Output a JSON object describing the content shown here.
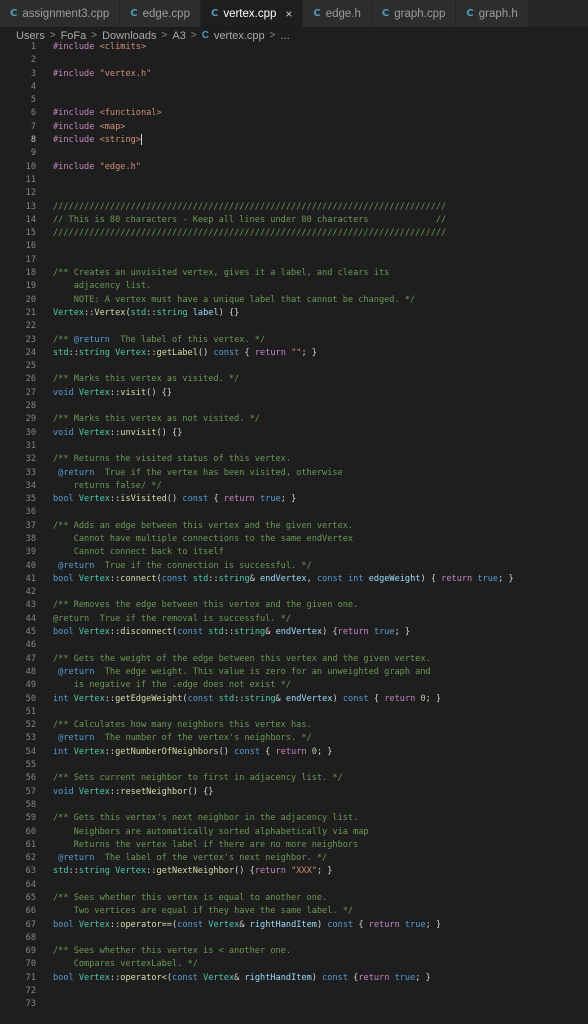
{
  "tabs": [
    {
      "label": "assignment3.cpp",
      "icon": "c-file-icon",
      "active": false
    },
    {
      "label": "edge.cpp",
      "icon": "c-file-icon",
      "active": false
    },
    {
      "label": "vertex.cpp",
      "icon": "c-file-icon",
      "active": true,
      "close": "×"
    },
    {
      "label": "edge.h",
      "icon": "c-file-icon",
      "active": false
    },
    {
      "label": "graph.cpp",
      "icon": "c-file-icon",
      "active": false
    },
    {
      "label": "graph.h",
      "icon": "c-file-icon",
      "active": false
    }
  ],
  "breadcrumb": {
    "items": [
      "Users",
      "FoFa",
      "Downloads",
      "A3",
      "vertex.cpp",
      "..."
    ],
    "separator": ">"
  },
  "editor": {
    "current_line": 8,
    "lines": [
      [
        [
          "#include ",
          "inc"
        ],
        [
          "<climits>",
          "str"
        ]
      ],
      [],
      [
        [
          "#include ",
          "inc"
        ],
        [
          "\"vertex.h\"",
          "str"
        ]
      ],
      [],
      [],
      [
        [
          "#include ",
          "inc"
        ],
        [
          "<functional>",
          "str"
        ]
      ],
      [
        [
          "#include ",
          "inc"
        ],
        [
          "<map>",
          "str"
        ]
      ],
      [
        [
          "#include ",
          "inc"
        ],
        [
          "<string>",
          "str"
        ]
      ],
      [],
      [
        [
          "#include ",
          "inc"
        ],
        [
          "\"edge.h\"",
          "str"
        ]
      ],
      [],
      [],
      [
        [
          "////////////////////////////////////////////////////////////////////////////",
          "cm"
        ]
      ],
      [
        [
          "// This is 80 characters - Keep all lines under 80 characters             //",
          "cm"
        ]
      ],
      [
        [
          "////////////////////////////////////////////////////////////////////////////",
          "cm"
        ]
      ],
      [],
      [],
      [
        [
          "/** Creates an unvisited vertex, gives it a label, and clears its",
          "cm"
        ]
      ],
      [
        [
          "    adjacency list.",
          "cm"
        ]
      ],
      [
        [
          "    NOTE: A vertex must have a unique label that cannot be changed. */",
          "cm"
        ]
      ],
      [
        [
          "Vertex",
          "ty"
        ],
        [
          "::",
          "pl"
        ],
        [
          "Vertex",
          "fn"
        ],
        [
          "(",
          "pl"
        ],
        [
          "std",
          "ty"
        ],
        [
          "::",
          "pl"
        ],
        [
          "string",
          "ty"
        ],
        [
          " label",
          "var"
        ],
        [
          ") {}",
          "pl"
        ]
      ],
      [],
      [
        [
          "/** ",
          "cm"
        ],
        [
          "@return",
          "kw"
        ],
        [
          "  The label of this vertex. */",
          "cm"
        ]
      ],
      [
        [
          "std",
          "ty"
        ],
        [
          "::",
          "pl"
        ],
        [
          "string ",
          "ty"
        ],
        [
          "Vertex",
          "ty"
        ],
        [
          "::",
          "pl"
        ],
        [
          "getLabel",
          "fn"
        ],
        [
          "() ",
          "pl"
        ],
        [
          "const",
          "kw"
        ],
        [
          " { ",
          "pl"
        ],
        [
          "return",
          "ctl"
        ],
        [
          " ",
          "pl"
        ],
        [
          "\"\"",
          "str"
        ],
        [
          "; }",
          "pl"
        ]
      ],
      [],
      [
        [
          "/** Marks this vertex as visited. */",
          "cm"
        ]
      ],
      [
        [
          "void ",
          "kw"
        ],
        [
          "Vertex",
          "ty"
        ],
        [
          "::",
          "pl"
        ],
        [
          "visit",
          "fn"
        ],
        [
          "() {}",
          "pl"
        ]
      ],
      [],
      [
        [
          "/** Marks this vertex as not visited. */",
          "cm"
        ]
      ],
      [
        [
          "void ",
          "kw"
        ],
        [
          "Vertex",
          "ty"
        ],
        [
          "::",
          "pl"
        ],
        [
          "unvisit",
          "fn"
        ],
        [
          "() {}",
          "pl"
        ]
      ],
      [],
      [
        [
          "/** Returns the visited status of this vertex.",
          "cm"
        ]
      ],
      [
        [
          " @return",
          "kw"
        ],
        [
          "  True if the vertex has been visited, otherwise",
          "cm"
        ]
      ],
      [
        [
          "    returns false/ */",
          "cm"
        ]
      ],
      [
        [
          "bool ",
          "kw"
        ],
        [
          "Vertex",
          "ty"
        ],
        [
          "::",
          "pl"
        ],
        [
          "isVisited",
          "fn"
        ],
        [
          "() ",
          "pl"
        ],
        [
          "const",
          "kw"
        ],
        [
          " { ",
          "pl"
        ],
        [
          "return",
          "ctl"
        ],
        [
          " true",
          "kw"
        ],
        [
          "; }",
          "pl"
        ]
      ],
      [],
      [
        [
          "/** Adds an edge between this vertex and the given vertex.",
          "cm"
        ]
      ],
      [
        [
          "    Cannot have multiple connections to the same endVertex",
          "cm"
        ]
      ],
      [
        [
          "    Cannot connect back to itself",
          "cm"
        ]
      ],
      [
        [
          " @return",
          "kw"
        ],
        [
          "  True if the connection is successful. */",
          "cm"
        ]
      ],
      [
        [
          "bool ",
          "kw"
        ],
        [
          "Vertex",
          "ty"
        ],
        [
          "::",
          "pl"
        ],
        [
          "connect",
          "fn"
        ],
        [
          "(",
          "pl"
        ],
        [
          "const ",
          "kw"
        ],
        [
          "std",
          "ty"
        ],
        [
          "::",
          "pl"
        ],
        [
          "string",
          "ty"
        ],
        [
          "& ",
          "pl"
        ],
        [
          "endVertex",
          "var"
        ],
        [
          ", ",
          "pl"
        ],
        [
          "const int ",
          "kw"
        ],
        [
          "edgeWeight",
          "var"
        ],
        [
          ") { ",
          "pl"
        ],
        [
          "return",
          "ctl"
        ],
        [
          " true",
          "kw"
        ],
        [
          "; }",
          "pl"
        ]
      ],
      [],
      [
        [
          "/** Removes the edge between this vertex and the given one.",
          "cm"
        ]
      ],
      [
        [
          "@return  True if the removal is successful. */",
          "cm"
        ]
      ],
      [
        [
          "bool ",
          "kw"
        ],
        [
          "Vertex",
          "ty"
        ],
        [
          "::",
          "pl"
        ],
        [
          "disconnect",
          "fn"
        ],
        [
          "(",
          "pl"
        ],
        [
          "const ",
          "kw"
        ],
        [
          "std",
          "ty"
        ],
        [
          "::",
          "pl"
        ],
        [
          "string",
          "ty"
        ],
        [
          "& ",
          "pl"
        ],
        [
          "endVertex",
          "var"
        ],
        [
          ") {",
          "pl"
        ],
        [
          "return",
          "ctl"
        ],
        [
          " true",
          "kw"
        ],
        [
          "; }",
          "pl"
        ]
      ],
      [],
      [
        [
          "/** Gets the weight of the edge between this vertex and the given vertex.",
          "cm"
        ]
      ],
      [
        [
          " @return",
          "kw"
        ],
        [
          "  The edge weight. This value is zero for an unweighted graph and",
          "cm"
        ]
      ],
      [
        [
          "    is negative if the .edge does not exist */",
          "cm"
        ]
      ],
      [
        [
          "int ",
          "kw"
        ],
        [
          "Vertex",
          "ty"
        ],
        [
          "::",
          "pl"
        ],
        [
          "getEdgeWeight",
          "fn"
        ],
        [
          "(",
          "pl"
        ],
        [
          "const ",
          "kw"
        ],
        [
          "std",
          "ty"
        ],
        [
          "::",
          "pl"
        ],
        [
          "string",
          "ty"
        ],
        [
          "& ",
          "pl"
        ],
        [
          "endVertex",
          "var"
        ],
        [
          ") ",
          "pl"
        ],
        [
          "const",
          "kw"
        ],
        [
          " { ",
          "pl"
        ],
        [
          "return",
          "ctl"
        ],
        [
          " 0",
          "num"
        ],
        [
          "; }",
          "pl"
        ]
      ],
      [],
      [
        [
          "/** Calculates how many neighbors this vertex has.",
          "cm"
        ]
      ],
      [
        [
          " @return",
          "kw"
        ],
        [
          "  The number of the vertex's neighbors. */",
          "cm"
        ]
      ],
      [
        [
          "int ",
          "kw"
        ],
        [
          "Vertex",
          "ty"
        ],
        [
          "::",
          "pl"
        ],
        [
          "getNumberOfNeighbors",
          "fn"
        ],
        [
          "() ",
          "pl"
        ],
        [
          "const",
          "kw"
        ],
        [
          " { ",
          "pl"
        ],
        [
          "return",
          "ctl"
        ],
        [
          " 0",
          "num"
        ],
        [
          "; }",
          "pl"
        ]
      ],
      [],
      [
        [
          "/** Sets current neighbor to first in adjacency list. */",
          "cm"
        ]
      ],
      [
        [
          "void ",
          "kw"
        ],
        [
          "Vertex",
          "ty"
        ],
        [
          "::",
          "pl"
        ],
        [
          "resetNeighbor",
          "fn"
        ],
        [
          "() {}",
          "pl"
        ]
      ],
      [],
      [
        [
          "/** Gets this vertex's next neighbor in the adjacency list.",
          "cm"
        ]
      ],
      [
        [
          "    Neighbors are automatically sorted alphabetically via map",
          "cm"
        ]
      ],
      [
        [
          "    Returns the vertex label if there are no more neighbors",
          "cm"
        ]
      ],
      [
        [
          " @return",
          "kw"
        ],
        [
          "  The label of the vertex's next neighbor. */",
          "cm"
        ]
      ],
      [
        [
          "std",
          "ty"
        ],
        [
          "::",
          "pl"
        ],
        [
          "string ",
          "ty"
        ],
        [
          "Vertex",
          "ty"
        ],
        [
          "::",
          "pl"
        ],
        [
          "getNextNeighbor",
          "fn"
        ],
        [
          "() {",
          "pl"
        ],
        [
          "return",
          "ctl"
        ],
        [
          " ",
          "pl"
        ],
        [
          "\"XXX\"",
          "str"
        ],
        [
          "; }",
          "pl"
        ]
      ],
      [],
      [
        [
          "/** Sees whether this vertex is equal to another one.",
          "cm"
        ]
      ],
      [
        [
          "    Two vertices are equal if they have the same label. */",
          "cm"
        ]
      ],
      [
        [
          "bool ",
          "kw"
        ],
        [
          "Vertex",
          "ty"
        ],
        [
          "::",
          "pl"
        ],
        [
          "operator==",
          "fn"
        ],
        [
          "(",
          "pl"
        ],
        [
          "const ",
          "kw"
        ],
        [
          "Vertex",
          "ty"
        ],
        [
          "& ",
          "pl"
        ],
        [
          "rightHandItem",
          "var"
        ],
        [
          ") ",
          "pl"
        ],
        [
          "const",
          "kw"
        ],
        [
          " { ",
          "pl"
        ],
        [
          "return",
          "ctl"
        ],
        [
          " true",
          "kw"
        ],
        [
          "; }",
          "pl"
        ]
      ],
      [],
      [
        [
          "/** Sees whether this vertex is < another one.",
          "cm"
        ]
      ],
      [
        [
          "    Compares vertexLabel. */",
          "cm"
        ]
      ],
      [
        [
          "bool ",
          "kw"
        ],
        [
          "Vertex",
          "ty"
        ],
        [
          "::",
          "pl"
        ],
        [
          "operator<",
          "fn"
        ],
        [
          "(",
          "pl"
        ],
        [
          "const ",
          "kw"
        ],
        [
          "Vertex",
          "ty"
        ],
        [
          "& ",
          "pl"
        ],
        [
          "rightHandItem",
          "var"
        ],
        [
          ") ",
          "pl"
        ],
        [
          "const",
          "kw"
        ],
        [
          " {",
          "pl"
        ],
        [
          "return",
          "ctl"
        ],
        [
          " true",
          "kw"
        ],
        [
          "; }",
          "pl"
        ]
      ],
      [],
      []
    ]
  }
}
